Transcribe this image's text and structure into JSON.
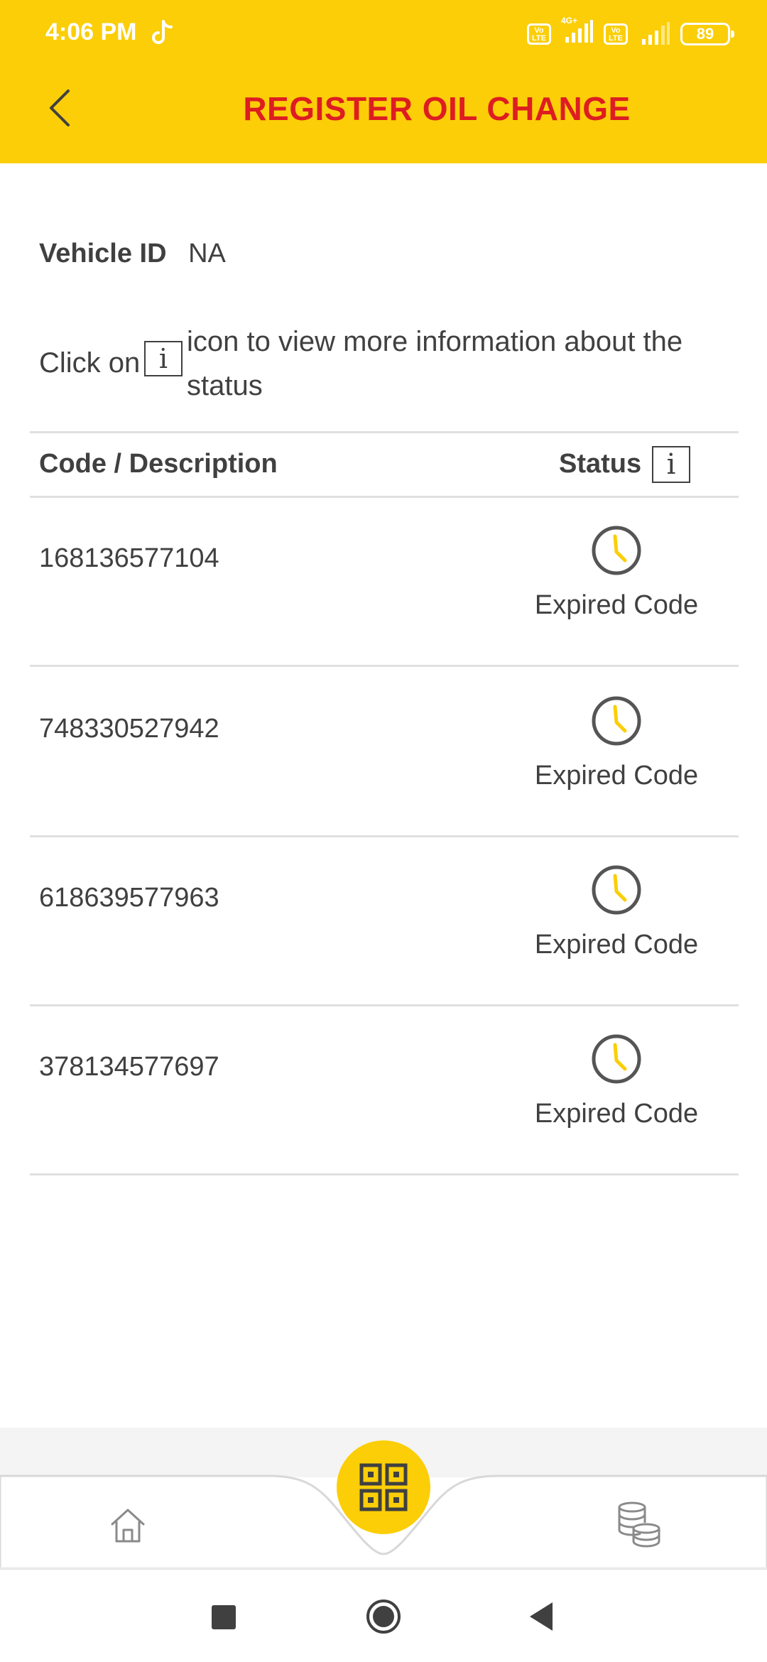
{
  "status_bar": {
    "time": "4:06 PM",
    "sim1_badge": "Vo LTE",
    "network_type": "4G+",
    "sim2_badge": "Vo LTE",
    "battery_level": "89"
  },
  "header": {
    "title": "REGISTER OIL CHANGE",
    "back_icon": "chevron-left-icon"
  },
  "vehicle": {
    "label": "Vehicle ID",
    "value": "NA"
  },
  "info": {
    "prefix": "Click on",
    "icon_glyph": "i",
    "rest": "icon to view more information about the status"
  },
  "table": {
    "col_code": "Code / Description",
    "col_status": "Status",
    "status_info_glyph": "i",
    "rows": [
      {
        "code": "168136577104",
        "status": "Expired Code",
        "icon": "clock-icon"
      },
      {
        "code": "748330527942",
        "status": "Expired Code",
        "icon": "clock-icon"
      },
      {
        "code": "618639577963",
        "status": "Expired Code",
        "icon": "clock-icon"
      },
      {
        "code": "378134577697",
        "status": "Expired Code",
        "icon": "clock-icon"
      }
    ]
  },
  "bottom_nav": {
    "items": [
      "home-icon",
      "qr-code-icon",
      "coins-icon"
    ]
  },
  "colors": {
    "brand_yellow": "#FBCE07",
    "brand_red": "#DD1D21",
    "text": "#404040"
  }
}
